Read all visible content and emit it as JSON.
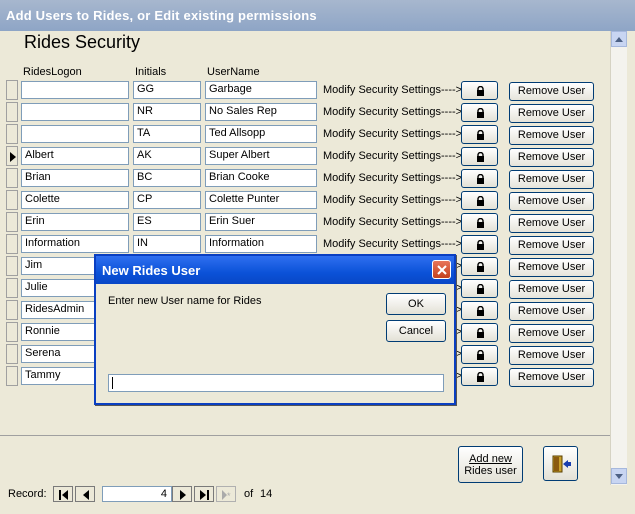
{
  "window": {
    "title": "Add Users to Rides, or Edit existing permissions"
  },
  "form": {
    "title": "Rides Security"
  },
  "columns": {
    "logon": "RidesLogon",
    "initials": "Initials",
    "username": "UserName"
  },
  "modify_label": "Modify Security Settings---->",
  "remove_label": "Remove User",
  "rows": [
    {
      "logon": "",
      "initials": "GG",
      "username": "Garbage",
      "current": false
    },
    {
      "logon": "",
      "initials": "NR",
      "username": "No Sales Rep",
      "current": false
    },
    {
      "logon": "",
      "initials": "TA",
      "username": "Ted Allsopp",
      "current": false
    },
    {
      "logon": "Albert",
      "initials": "AK",
      "username": "Super Albert",
      "current": true
    },
    {
      "logon": "Brian",
      "initials": "BC",
      "username": "Brian Cooke",
      "current": false
    },
    {
      "logon": "Colette",
      "initials": "CP",
      "username": "Colette Punter",
      "current": false
    },
    {
      "logon": "Erin",
      "initials": "ES",
      "username": "Erin Suer",
      "current": false
    },
    {
      "logon": "Information",
      "initials": "IN",
      "username": "Information",
      "current": false
    },
    {
      "logon": "Jim",
      "initials": "",
      "username": "",
      "current": false
    },
    {
      "logon": "Julie",
      "initials": "",
      "username": "",
      "current": false
    },
    {
      "logon": "RidesAdmin",
      "initials": "",
      "username": "",
      "current": false
    },
    {
      "logon": "Ronnie",
      "initials": "",
      "username": "",
      "current": false
    },
    {
      "logon": "Serena",
      "initials": "",
      "username": "",
      "current": false
    },
    {
      "logon": "Tammy",
      "initials": "",
      "username": "",
      "current": false
    }
  ],
  "footer": {
    "add_new_line1": "Add new",
    "add_new_line2": "Rides user",
    "exit_icon": "exit-door-icon"
  },
  "navigation": {
    "label": "Record:",
    "current": "4",
    "of_label": "of",
    "total": "14"
  },
  "dialog": {
    "title": "New Rides User",
    "prompt": "Enter new User name for Rides",
    "ok_label": "OK",
    "cancel_label": "Cancel",
    "input_value": ""
  },
  "colors": {
    "dialog_title": "#0b52d8",
    "window_title": "#8ea5c6",
    "background": "#ece9d8"
  }
}
